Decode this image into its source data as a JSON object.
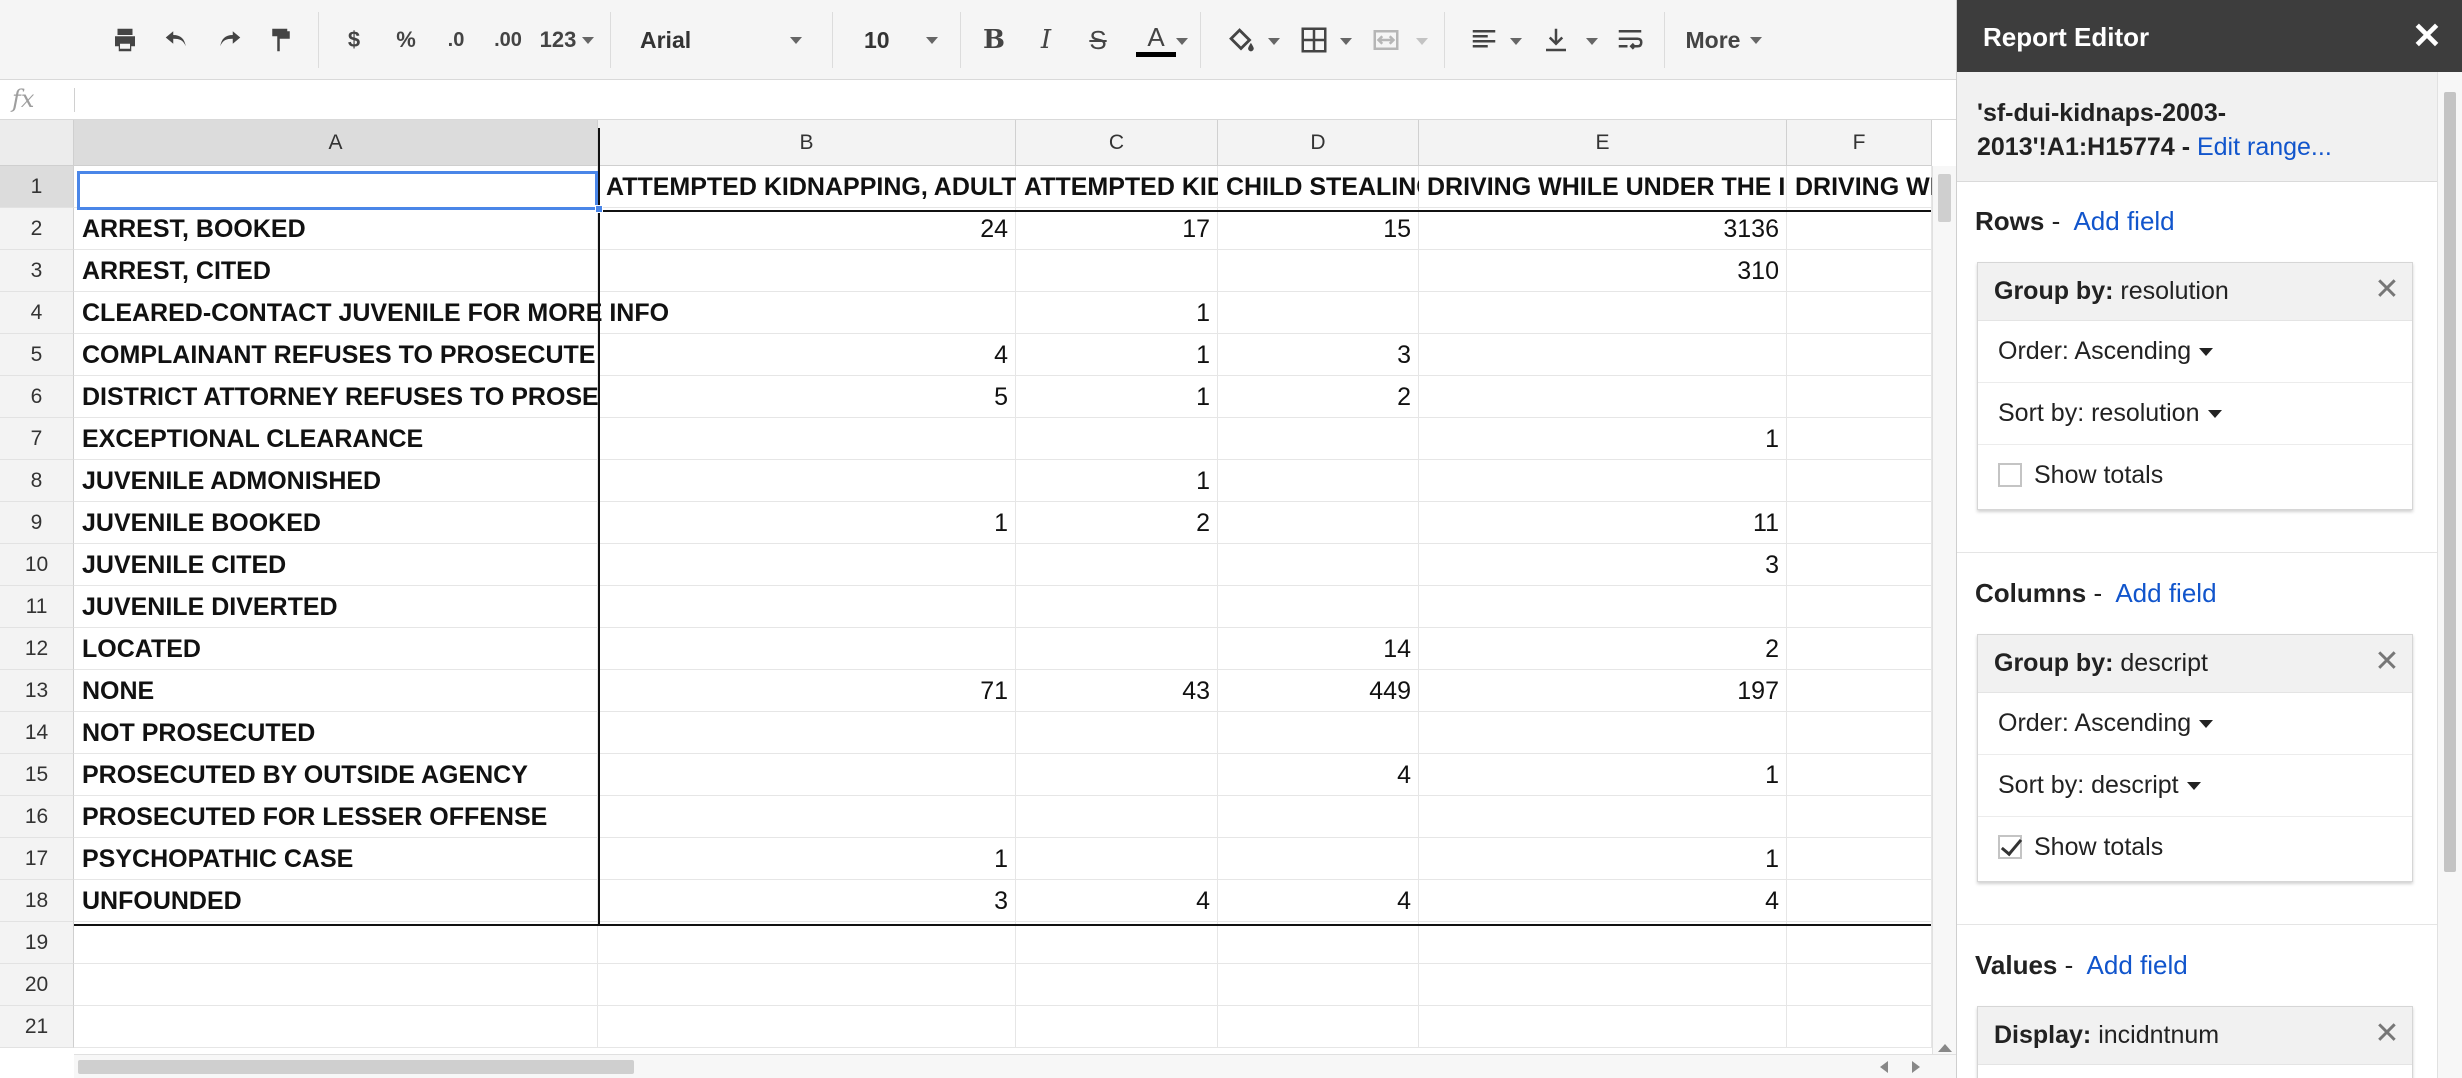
{
  "toolbar": {
    "number_format": "123",
    "font_name": "Arial",
    "font_size": "10",
    "more_label": "More",
    "currency_symbol": "$",
    "percent_symbol": "%",
    "decrease_decimal": ".0",
    "increase_decimal": ".00"
  },
  "formula_bar": {
    "fx_label": "fx",
    "value": ""
  },
  "grid": {
    "columns": [
      "A",
      "B",
      "C",
      "D",
      "E",
      "F"
    ],
    "rows": [
      "1",
      "2",
      "3",
      "4",
      "5",
      "6",
      "7",
      "8",
      "9",
      "10",
      "11",
      "12",
      "13",
      "14",
      "15",
      "16",
      "17",
      "18",
      "19",
      "20",
      "21"
    ],
    "header_cells": [
      "ATTEMPTED KIDNAPPING, ADULT VICTIM",
      "ATTEMPTED KIDNAPPING, JUVENILE VICTIM",
      "CHILD STEALING",
      "DRIVING WHILE UNDER THE INFLUENCE OF ALCOHOL",
      "DRIVING WHILE UNDER THE INFLUENCE OF DRUGS"
    ],
    "data_rows": [
      {
        "label": "ARREST, BOOKED",
        "values": [
          "24",
          "17",
          "15",
          "3136",
          ""
        ]
      },
      {
        "label": "ARREST, CITED",
        "values": [
          "",
          "",
          "",
          "310",
          ""
        ]
      },
      {
        "label": "CLEARED-CONTACT JUVENILE FOR MORE INFO",
        "values": [
          "",
          "1",
          "",
          "",
          ""
        ]
      },
      {
        "label": "COMPLAINANT REFUSES TO PROSECUTE",
        "values": [
          "4",
          "1",
          "3",
          "",
          ""
        ]
      },
      {
        "label": "DISTRICT ATTORNEY REFUSES TO PROSECUTE",
        "values": [
          "5",
          "1",
          "2",
          "",
          ""
        ]
      },
      {
        "label": "EXCEPTIONAL CLEARANCE",
        "values": [
          "",
          "",
          "",
          "1",
          ""
        ]
      },
      {
        "label": "JUVENILE ADMONISHED",
        "values": [
          "",
          "1",
          "",
          "",
          ""
        ]
      },
      {
        "label": "JUVENILE BOOKED",
        "values": [
          "1",
          "2",
          "",
          "11",
          ""
        ]
      },
      {
        "label": "JUVENILE CITED",
        "values": [
          "",
          "",
          "",
          "3",
          ""
        ]
      },
      {
        "label": "JUVENILE DIVERTED",
        "values": [
          "",
          "",
          "",
          "",
          ""
        ]
      },
      {
        "label": "LOCATED",
        "values": [
          "",
          "",
          "14",
          "2",
          ""
        ]
      },
      {
        "label": "NONE",
        "values": [
          "71",
          "43",
          "449",
          "197",
          ""
        ]
      },
      {
        "label": "NOT PROSECUTED",
        "values": [
          "",
          "",
          "",
          "",
          ""
        ]
      },
      {
        "label": "PROSECUTED BY OUTSIDE AGENCY",
        "values": [
          "",
          "",
          "4",
          "1",
          ""
        ]
      },
      {
        "label": "PROSECUTED FOR LESSER OFFENSE",
        "values": [
          "",
          "",
          "",
          "",
          ""
        ]
      },
      {
        "label": "PSYCHOPATHIC CASE",
        "values": [
          "1",
          "",
          "",
          "1",
          ""
        ]
      },
      {
        "label": "UNFOUNDED",
        "values": [
          "3",
          "4",
          "4",
          "4",
          ""
        ]
      }
    ]
  },
  "report_editor": {
    "title": "Report Editor",
    "close": "✕",
    "range_text": "'sf-dui-kidnaps-2003-2013'!A1:H15774 -",
    "edit_range_label": "Edit range...",
    "rows_section": {
      "title": "Rows",
      "add_field": "Add field",
      "card": {
        "group_by_label": "Group by:",
        "group_by_value": "resolution",
        "order": "Order: Ascending",
        "sort": "Sort by: resolution",
        "show_totals": "Show totals",
        "show_totals_checked": false
      }
    },
    "columns_section": {
      "title": "Columns",
      "add_field": "Add field",
      "card": {
        "group_by_label": "Group by:",
        "group_by_value": "descript",
        "order": "Order: Ascending",
        "sort": "Sort by: descript",
        "show_totals": "Show totals",
        "show_totals_checked": true
      }
    },
    "values_section": {
      "title": "Values",
      "add_field": "Add field",
      "card": {
        "display_label": "Display:",
        "display_value": "incidntnum"
      }
    }
  },
  "colors": {
    "accent_blue": "#4a86e8",
    "link_blue": "#1155cc",
    "panel_header": "#3d3d3d"
  }
}
